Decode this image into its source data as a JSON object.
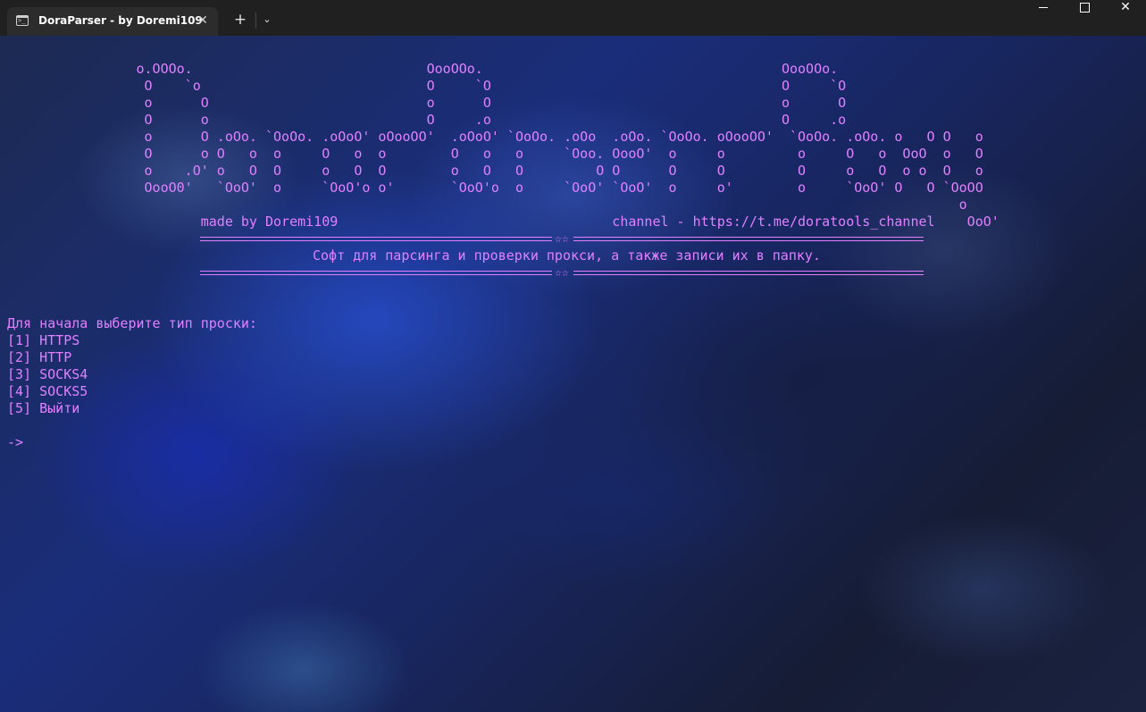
{
  "window": {
    "tab_title": "DoraParser - by Doremi109",
    "tab_icon": "terminal-icon",
    "close_tab": "✕",
    "new_tab": "+",
    "dropdown": "⌄",
    "close_window": "✕"
  },
  "terminal": {
    "ascii_art": [
      "                o.OOOo.                             OooOOo.                                     OooOOo.",
      "                 O    `o                            O     `O                                    O     `O",
      "                 o      O                           o      O                                    o      O",
      "                 O      o                           O     .o                                    O     .o",
      "                 o      O .oOo. `OoOo. .oOoO' oOooOO'  .oOoO' `OoOo. .oOo  .oOo. `OoOo. oOooOO'  `OoOo. .oOo. o   O O   o",
      "                 O      o O   o  o     O   o  o        O   o   o     `Ooo. OooO'  o     o         o     O   o  OoO  o   O",
      "                 o    .O' o   O  O     o   O  O        o   O   O         O O      O     O         O     o   O  o o  O   o",
      "                 OooO0'   `OoO'  o     `OoO'o o'       `OoO'o  o     `OoO' `OoO'  o     o'        o     `OoO' O   O `OoOO",
      "                                                                                                                      o",
      "                        made by Doremi109                                  channel - https://t.me/doratools_channel    OoO'"
    ],
    "tagline": "Софт для парсинга и проверки прокси, а также записи их в папку.",
    "stars": "☆☆",
    "prompt_heading": "Для начала выберите тип проски:",
    "options": [
      "[1] HTTPS",
      "[2] HTTP",
      "[3] SOCKS4",
      "[4] SOCKS5",
      "[5] Выйти"
    ],
    "input_prompt": "->"
  },
  "colors": {
    "terminal_text": "#e080ff",
    "titlebar": "#202020",
    "tab": "#2c2c2c"
  }
}
